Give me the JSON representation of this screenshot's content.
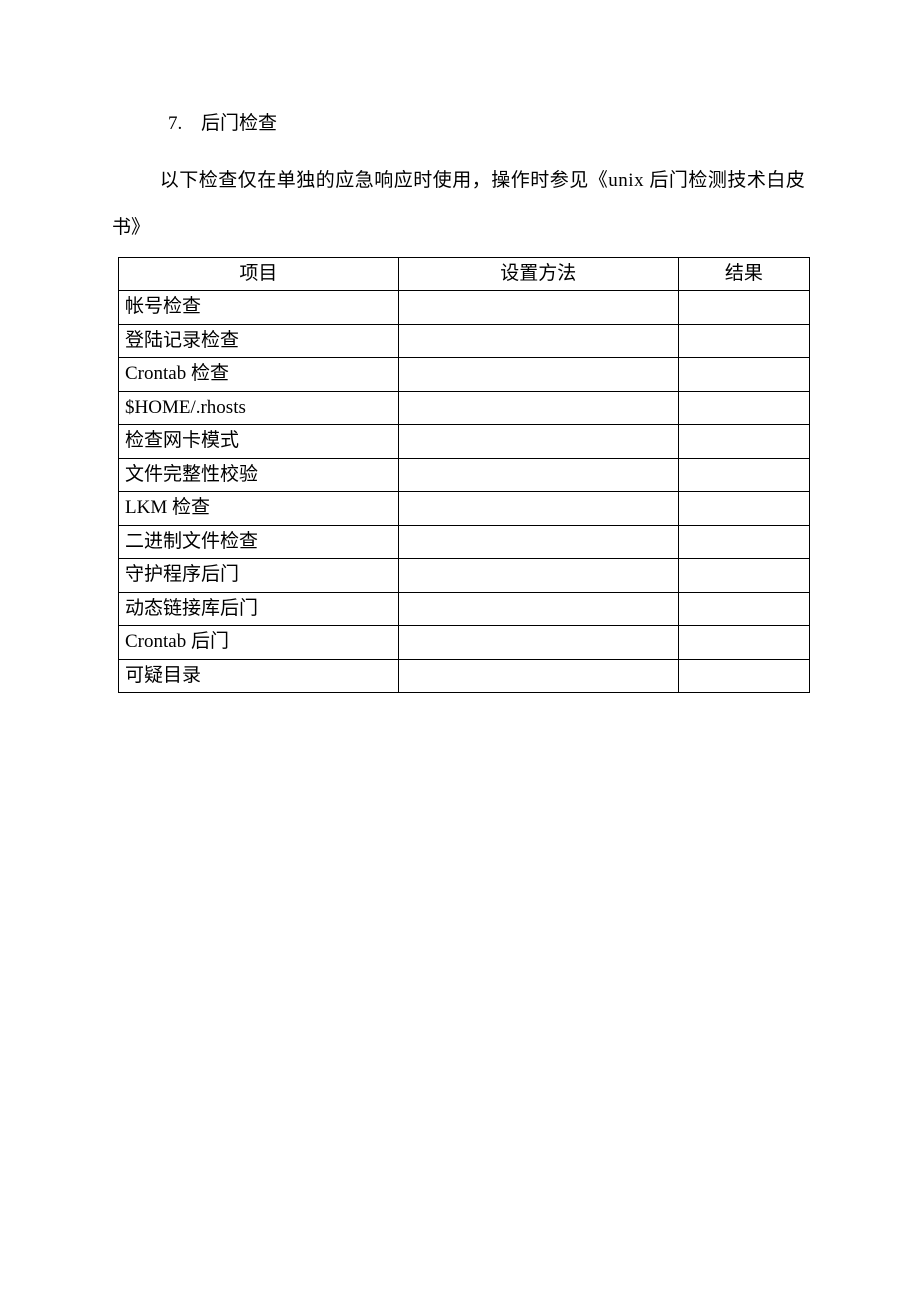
{
  "heading": {
    "number": "7.",
    "title": "后门检查"
  },
  "paragraph": {
    "line1": "以下检查仅在单独的应急响应时使用，操作时参见《unix 后门检测技术白皮",
    "line2": "书》"
  },
  "table": {
    "headers": {
      "item": "项目",
      "method": "设置方法",
      "result": "结果"
    },
    "rows": [
      {
        "item": "帐号检查",
        "method": "",
        "result": ""
      },
      {
        "item": "登陆记录检查",
        "method": "",
        "result": ""
      },
      {
        "item": "Crontab 检查",
        "method": "",
        "result": ""
      },
      {
        "item": "$HOME/.rhosts",
        "method": "",
        "result": ""
      },
      {
        "item": "检查网卡模式",
        "method": "",
        "result": ""
      },
      {
        "item": "文件完整性校验",
        "method": "",
        "result": ""
      },
      {
        "item": "LKM 检查",
        "method": "",
        "result": ""
      },
      {
        "item": "二进制文件检查",
        "method": "",
        "result": ""
      },
      {
        "item": "守护程序后门",
        "method": "",
        "result": ""
      },
      {
        "item": "动态链接库后门",
        "method": "",
        "result": ""
      },
      {
        "item": "Crontab 后门",
        "method": "",
        "result": ""
      },
      {
        "item": "可疑目录",
        "method": "",
        "result": ""
      }
    ]
  }
}
